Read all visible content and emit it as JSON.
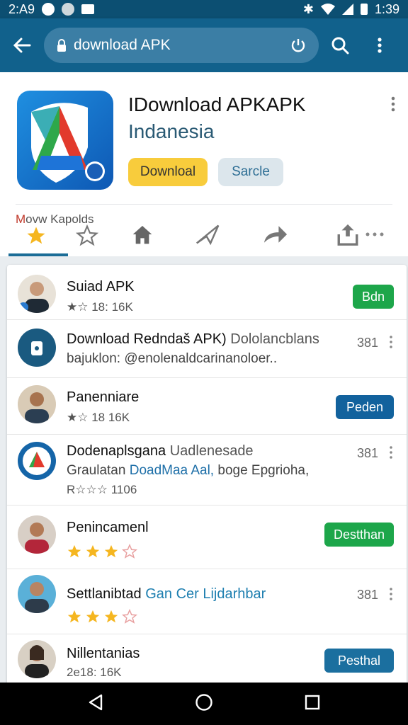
{
  "status_bar": {
    "time_left": "2:A9",
    "time_right": "1:39"
  },
  "toolbar": {
    "url": "download APK"
  },
  "app": {
    "title": "IDownload APKAPK",
    "subtitle": "Indanesia",
    "download_label": "Downloal",
    "search_label": "Sarcle"
  },
  "tabs": {
    "label_red": "M",
    "label_rest": "ovw Kapolds"
  },
  "list": [
    {
      "title": "Suiad APK",
      "meta": "18: 16K",
      "action": "Bdn"
    },
    {
      "title": "Download Redndaš APK)",
      "title_extra": "Dololancblans",
      "line2": "bajuklon: @enolenaldcarinanoloer..",
      "count": "381"
    },
    {
      "title": "Panenniare",
      "meta": "18 16K",
      "action": "Peden"
    },
    {
      "title": "Dodenaplsgana",
      "title_extra": "Uadlenesade",
      "line2_a": "Graulatan",
      "line2_b": "DoadMaa Aal,",
      "line2_c": "boge Epgrioha,",
      "meta": "R☆☆☆ 1106",
      "count": "381"
    },
    {
      "title": "Penincamenl",
      "action": "Destthan"
    },
    {
      "title": "Settlanibtad",
      "title_extra": "Gan Cer Lijdarhbar",
      "count": "381"
    },
    {
      "title": "Nillentanias",
      "meta": "2e18: 16K",
      "action": "Pesthal"
    }
  ],
  "colors": {
    "toolbar": "#11618c",
    "statusbar": "#0c4f72",
    "accent_green": "#1da64a",
    "accent_blue": "#12629d",
    "download_yellow": "#f8cc3c"
  }
}
